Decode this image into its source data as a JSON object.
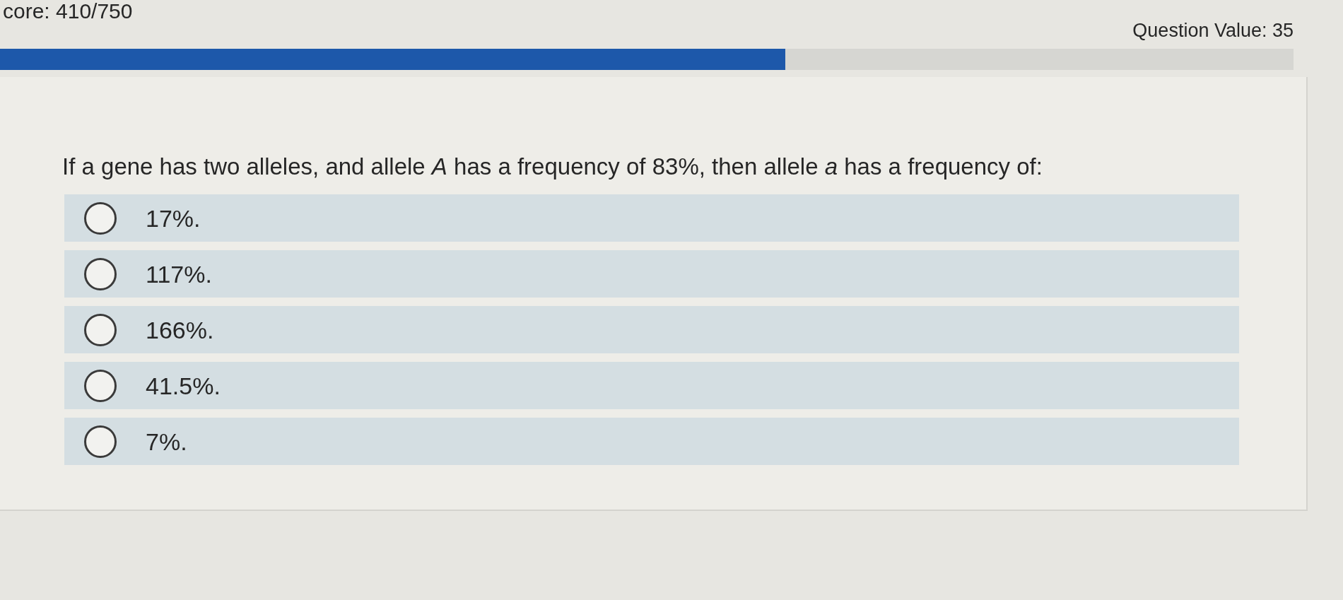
{
  "header": {
    "score": "core: 410/750",
    "question_value": "Question Value: 35"
  },
  "progress": {
    "level": 0.607
  },
  "question": {
    "text": "If a gene has two alleles, and allele *A* has a frequency of 83%, then allele *a* has a frequency of:",
    "options": [
      {
        "label": "17%.",
        "selected": false
      },
      {
        "label": "117%.",
        "selected": false
      },
      {
        "label": "166%.",
        "selected": false
      },
      {
        "label": "41.5%.",
        "selected": false
      },
      {
        "label": "7%.",
        "selected": false
      }
    ]
  }
}
